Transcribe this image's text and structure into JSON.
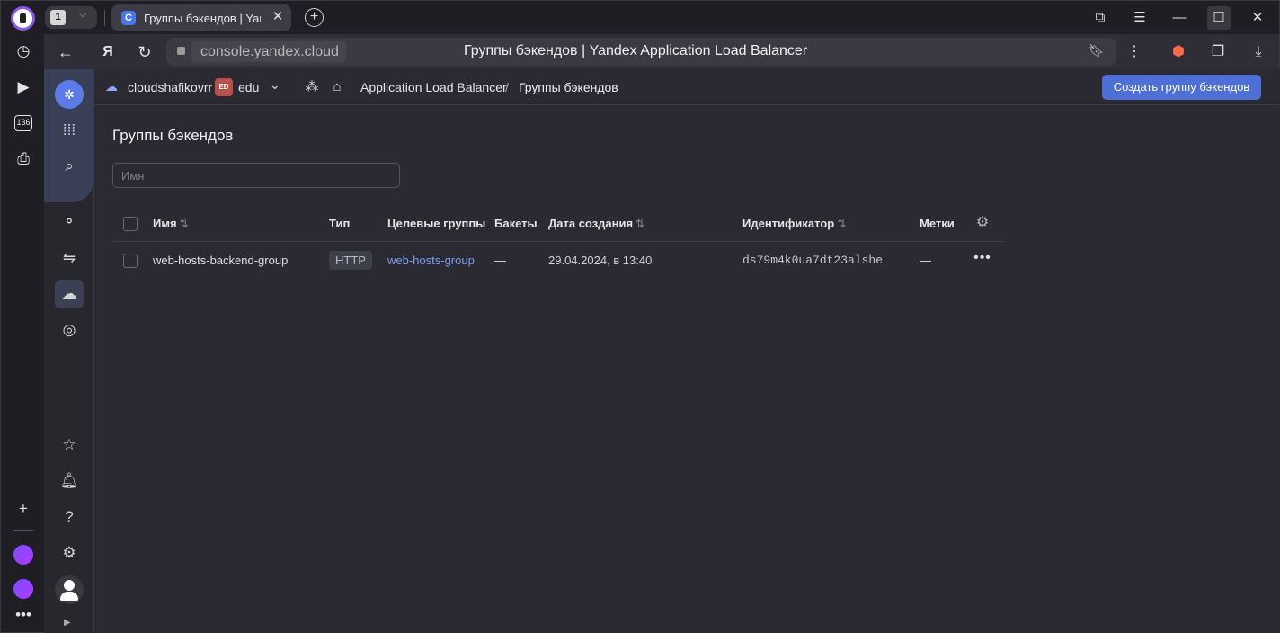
{
  "browser": {
    "tab_count": "1",
    "active_tab_title": "Группы бэкендов | Yandex Application Load Balancer",
    "domain": "console.yandex.cloud",
    "page_title": "Группы бэкендов | Yandex Application Load Balancer",
    "sidebar_badge": "136"
  },
  "console": {
    "cloud_name": "cloudshafikovrr",
    "folder_badge": "ED",
    "folder_name": "edu",
    "breadcrumb": {
      "service": "Application Load Balancer",
      "separator": "/",
      "current": "Группы бэкендов"
    },
    "create_button": "Создать группу бэкендов"
  },
  "main": {
    "heading": "Группы бэкендов",
    "filter_placeholder": "Имя",
    "table": {
      "columns": {
        "name": "Имя",
        "type": "Тип",
        "target_groups": "Целевые группы",
        "buckets": "Бакеты",
        "created": "Дата создания",
        "id": "Идентификатор",
        "labels": "Метки"
      },
      "sort_glyph": "⇅",
      "rows": [
        {
          "name": "web-hosts-backend-group",
          "type": "HTTP",
          "target_groups": "web-hosts-group",
          "buckets": "—",
          "created": "29.04.2024, в 13:40",
          "id": "ds79m4k0ua7dt23alshe",
          "labels": "—"
        }
      ]
    }
  },
  "icons": {
    "browser_sidebar": [
      "history-icon",
      "play-icon",
      "counter-icon",
      "screenshot-icon",
      "add-icon",
      "app-icon",
      "alice-icon",
      "more-icon"
    ],
    "console_nav": [
      "yandex-cloud-logo-icon",
      "services-grid-icon",
      "search-icon",
      "load-balancer-icon",
      "http-router-icon",
      "backend-group-icon",
      "target-group-icon",
      "favorites-icon",
      "notifications-icon",
      "help-icon",
      "settings-icon",
      "avatar"
    ]
  }
}
